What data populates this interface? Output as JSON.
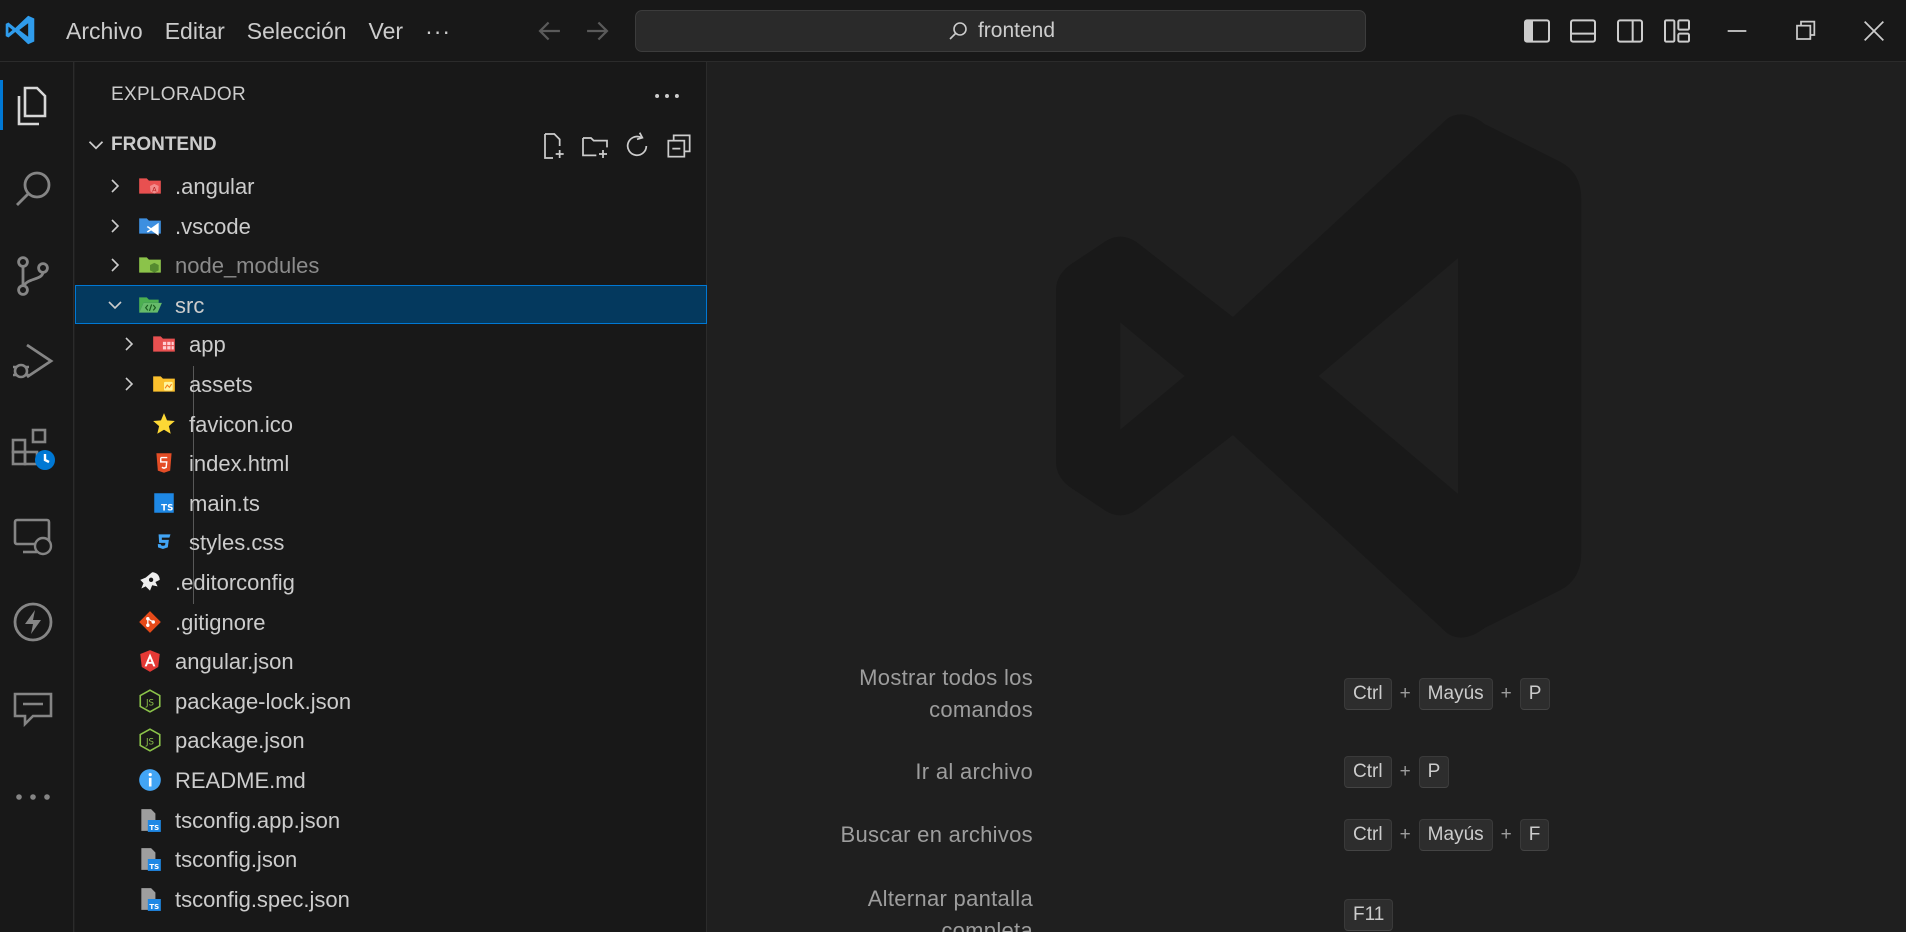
{
  "titlebar": {
    "menu": [
      "Archivo",
      "Editar",
      "Selección",
      "Ver"
    ],
    "more": "···",
    "search_text": "frontend"
  },
  "activitybar": {
    "icons": [
      "explorer-icon",
      "search-icon",
      "source-control-icon",
      "run-debug-icon",
      "extensions-icon",
      "remote-explorer-icon",
      "thunder-client-icon",
      "chat-icon",
      "more-icon"
    ]
  },
  "sidebar": {
    "title": "EXPLORADOR",
    "section": "FRONTEND",
    "items": [
      {
        "label": ".angular",
        "type": "folder",
        "icon": "angular-folder-icon"
      },
      {
        "label": ".vscode",
        "type": "folder",
        "icon": "vscode-folder-icon"
      },
      {
        "label": "node_modules",
        "type": "folder",
        "icon": "node-folder-icon"
      },
      {
        "label": "src",
        "type": "folder-open",
        "icon": "src-folder-icon",
        "selected": true
      },
      {
        "label": "app",
        "type": "folder",
        "icon": "app-folder-icon"
      },
      {
        "label": "assets",
        "type": "folder",
        "icon": "assets-folder-icon"
      },
      {
        "label": "favicon.ico",
        "type": "file",
        "icon": "star-icon"
      },
      {
        "label": "index.html",
        "type": "file",
        "icon": "html5-icon"
      },
      {
        "label": "main.ts",
        "type": "file",
        "icon": "typescript-icon"
      },
      {
        "label": "styles.css",
        "type": "file",
        "icon": "css3-icon"
      },
      {
        "label": ".editorconfig",
        "type": "file",
        "icon": "editorconfig-icon"
      },
      {
        "label": ".gitignore",
        "type": "file",
        "icon": "git-icon"
      },
      {
        "label": "angular.json",
        "type": "file",
        "icon": "angular-icon"
      },
      {
        "label": "package-lock.json",
        "type": "file",
        "icon": "nodejs-icon"
      },
      {
        "label": "package.json",
        "type": "file",
        "icon": "nodejs-icon"
      },
      {
        "label": "README.md",
        "type": "file",
        "icon": "info-icon"
      },
      {
        "label": "tsconfig.app.json",
        "type": "file",
        "icon": "tsconfig-icon"
      },
      {
        "label": "tsconfig.json",
        "type": "file",
        "icon": "tsconfig-icon"
      },
      {
        "label": "tsconfig.spec.json",
        "type": "file",
        "icon": "tsconfig-icon"
      }
    ]
  },
  "editor": {
    "shortcuts": [
      {
        "label_line1": "Mostrar todos los",
        "label_line2": "comandos",
        "keys": [
          "Ctrl",
          "Mayús",
          "P"
        ]
      },
      {
        "label_line1": "Ir al archivo",
        "label_line2": "",
        "keys": [
          "Ctrl",
          "P"
        ]
      },
      {
        "label_line1": "Buscar en archivos",
        "label_line2": "",
        "keys": [
          "Ctrl",
          "Mayús",
          "F"
        ]
      },
      {
        "label_line1": "Alternar pantalla",
        "label_line2": "completa",
        "keys": [
          "F11"
        ]
      }
    ]
  },
  "colors": {
    "accent": "#0078d4",
    "selection_bg": "#04395e",
    "sidebar_bg": "#181818",
    "editor_bg": "#1f1f1f"
  }
}
